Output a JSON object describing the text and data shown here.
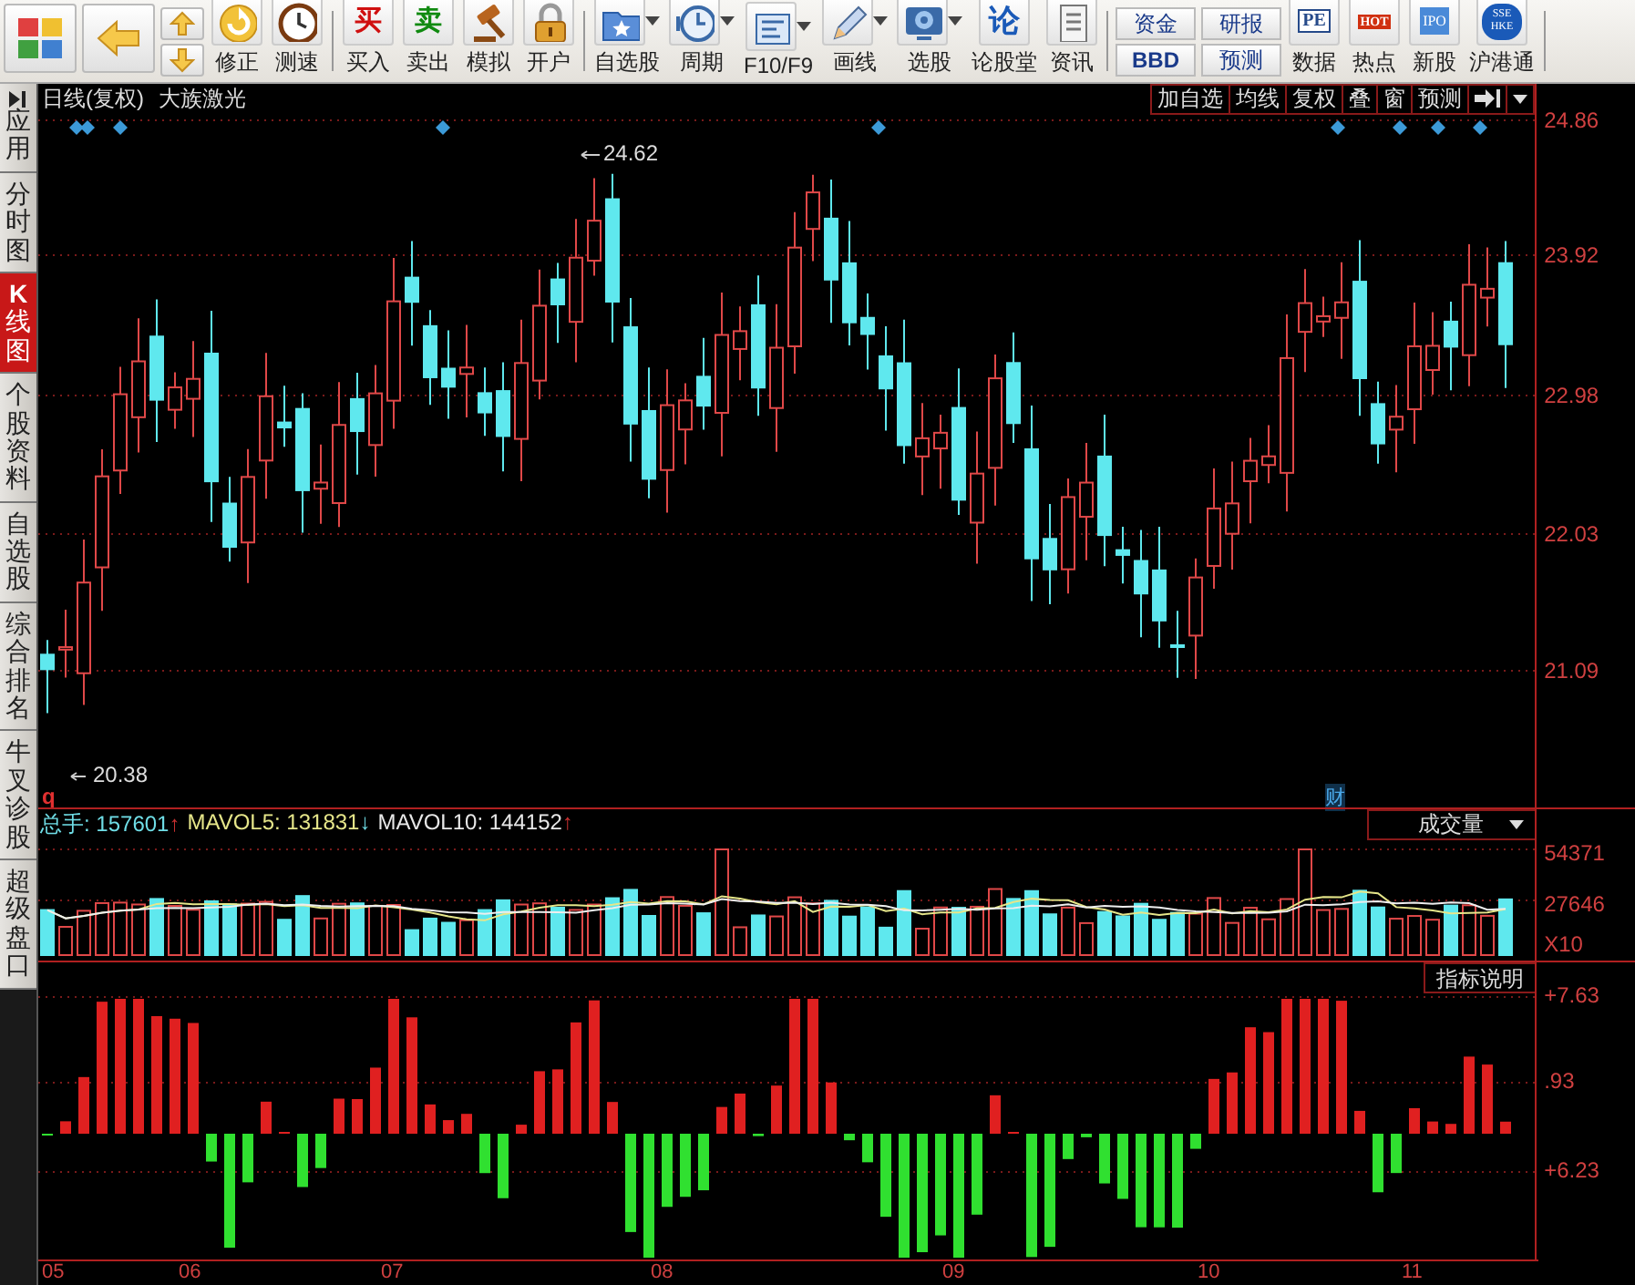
{
  "toolbar": {
    "items": [
      {
        "kind": "button",
        "label": "修正"
      },
      {
        "kind": "button",
        "label": "测速"
      },
      {
        "kind": "glyph",
        "glyph": "买",
        "label": "买入"
      },
      {
        "kind": "glyph",
        "glyph": "卖",
        "label": "卖出"
      },
      {
        "kind": "button",
        "label": "模拟"
      },
      {
        "kind": "button",
        "label": "开户"
      },
      {
        "kind": "dropdown",
        "label": "自选股"
      },
      {
        "kind": "dropdown",
        "label": "周期"
      },
      {
        "kind": "dropdown",
        "label": "F10/F9"
      },
      {
        "kind": "dropdown",
        "label": "画线"
      },
      {
        "kind": "dropdown",
        "label": "选股"
      },
      {
        "kind": "glyph",
        "glyph": "论",
        "label": "论股堂"
      },
      {
        "kind": "button",
        "label": "资讯"
      },
      {
        "kind": "stack",
        "top": "资金",
        "bottom": "BBD"
      },
      {
        "kind": "stack",
        "top": "研报",
        "bottom": "预测"
      },
      {
        "kind": "glyph",
        "glyph": "PE",
        "label": "数据"
      },
      {
        "kind": "glyph",
        "glyph": "HOT",
        "label": "热点"
      },
      {
        "kind": "glyph",
        "glyph": "IPO",
        "label": "新股"
      },
      {
        "kind": "glyph",
        "glyph": "SSE HKE",
        "label": "沪港通"
      }
    ]
  },
  "sidebar": {
    "tabs": [
      {
        "label": "应用",
        "selected": false
      },
      {
        "label": "分时图",
        "selected": false
      },
      {
        "label": "**K**线图",
        "selected": true
      },
      {
        "label": "个股资料",
        "selected": false
      },
      {
        "label": "自选股",
        "selected": false
      },
      {
        "label": "综合排名",
        "selected": false
      },
      {
        "label": "牛叉诊股",
        "selected": false
      },
      {
        "label": "超级盘口",
        "selected": false
      }
    ]
  },
  "chart": {
    "period": "日线(复权)",
    "stock": "大族激光",
    "buttons": [
      "加自选",
      "均线",
      "复权",
      "叠",
      "窗",
      "预测"
    ],
    "yticks": [
      "24.86",
      "23.92",
      "22.98",
      "22.03",
      "21.09"
    ],
    "high_label": "24.62",
    "low_label": "20.38",
    "marker_q": "q",
    "marker_cai": "财"
  },
  "volume": {
    "legend": [
      {
        "text": "总手: 157601",
        "arrow": "↑",
        "rising": true,
        "color": "#6fdde6"
      },
      {
        "text": "MAVOL5: 131831",
        "arrow": "↓",
        "rising": false,
        "color": "#e6e68a"
      },
      {
        "text": "MAVOL10: 144152",
        "arrow": "↑",
        "rising": true,
        "color": "#e8e8e8"
      }
    ],
    "selector": "成交量",
    "yticks": [
      "54371",
      "27646",
      "X10"
    ]
  },
  "indicator": {
    "button": "指标说明",
    "yticks": [
      "+7.63",
      ".93",
      "+6.23"
    ]
  },
  "dates": [
    "05",
    "06",
    "07",
    "08",
    "09",
    "10",
    "11"
  ]
}
